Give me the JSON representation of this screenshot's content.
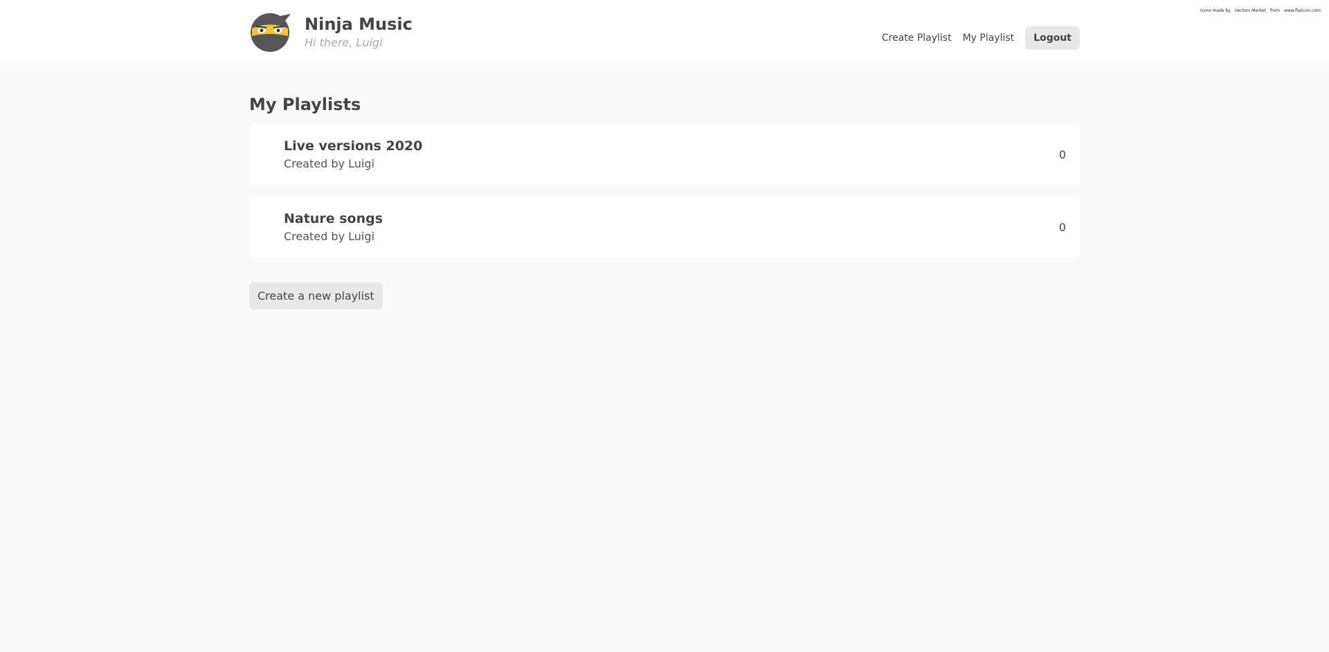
{
  "credit": {
    "prefix": "Icons made by",
    "author": "Vectors Market",
    "middle": "from",
    "site": "www.flaticon.com"
  },
  "header": {
    "title": "Ninja Music",
    "greeting": "Hi there, Luigi",
    "logo_icon": "ninja-avatar-icon"
  },
  "nav": {
    "create_playlist": "Create Playlist",
    "my_playlist": "My Playlist",
    "logout": "Logout"
  },
  "main": {
    "title": "My Playlists",
    "playlists": [
      {
        "title": "Live versions 2020",
        "creator": "Created by Luigi",
        "count": "0"
      },
      {
        "title": "Nature songs",
        "creator": "Created by Luigi",
        "count": "0"
      }
    ],
    "create_button": "Create a new playlist"
  },
  "colors": {
    "accent_yellow": "#f4c430",
    "ninja_gray": "#55565b",
    "button_bg": "#e8e8e8"
  }
}
